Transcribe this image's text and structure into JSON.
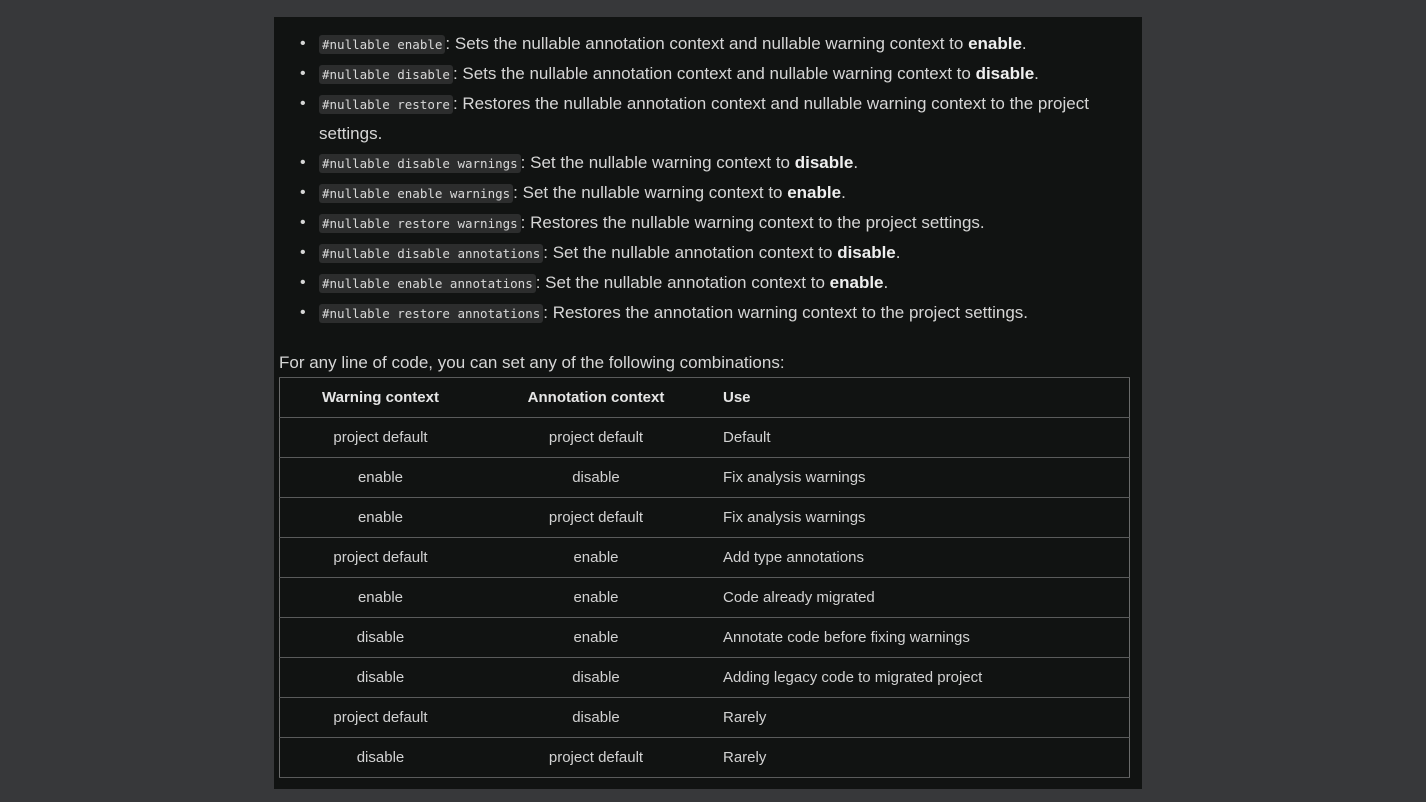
{
  "directives": [
    {
      "code": "#nullable enable",
      "pre": ": Sets the nullable annotation context and nullable warning context to ",
      "bold": "enable",
      "post": "."
    },
    {
      "code": "#nullable disable",
      "pre": ": Sets the nullable annotation context and nullable warning context to ",
      "bold": "disable",
      "post": "."
    },
    {
      "code": "#nullable restore",
      "pre": ": Restores the nullable annotation context and nullable warning context to the project settings.",
      "bold": "",
      "post": ""
    },
    {
      "code": "#nullable disable warnings",
      "pre": ": Set the nullable warning context to ",
      "bold": "disable",
      "post": "."
    },
    {
      "code": "#nullable enable warnings",
      "pre": ": Set the nullable warning context to ",
      "bold": "enable",
      "post": "."
    },
    {
      "code": "#nullable restore warnings",
      "pre": ": Restores the nullable warning context to the project settings.",
      "bold": "",
      "post": ""
    },
    {
      "code": "#nullable disable annotations",
      "pre": ": Set the nullable annotation context to ",
      "bold": "disable",
      "post": "."
    },
    {
      "code": "#nullable enable annotations",
      "pre": ": Set the nullable annotation context to ",
      "bold": "enable",
      "post": "."
    },
    {
      "code": "#nullable restore annotations",
      "pre": ": Restores the annotation warning context to the project settings.",
      "bold": "",
      "post": ""
    }
  ],
  "intro": "For any line of code, you can set any of the following combinations:",
  "table": {
    "headers": [
      "Warning context",
      "Annotation context",
      "Use"
    ],
    "rows": [
      [
        "project default",
        "project default",
        "Default"
      ],
      [
        "enable",
        "disable",
        "Fix analysis warnings"
      ],
      [
        "enable",
        "project default",
        "Fix analysis warnings"
      ],
      [
        "project default",
        "enable",
        "Add type annotations"
      ],
      [
        "enable",
        "enable",
        "Code already migrated"
      ],
      [
        "disable",
        "enable",
        "Annotate code before fixing warnings"
      ],
      [
        "disable",
        "disable",
        "Adding legacy code to migrated project"
      ],
      [
        "project default",
        "disable",
        "Rarely"
      ],
      [
        "disable",
        "project default",
        "Rarely"
      ]
    ]
  }
}
